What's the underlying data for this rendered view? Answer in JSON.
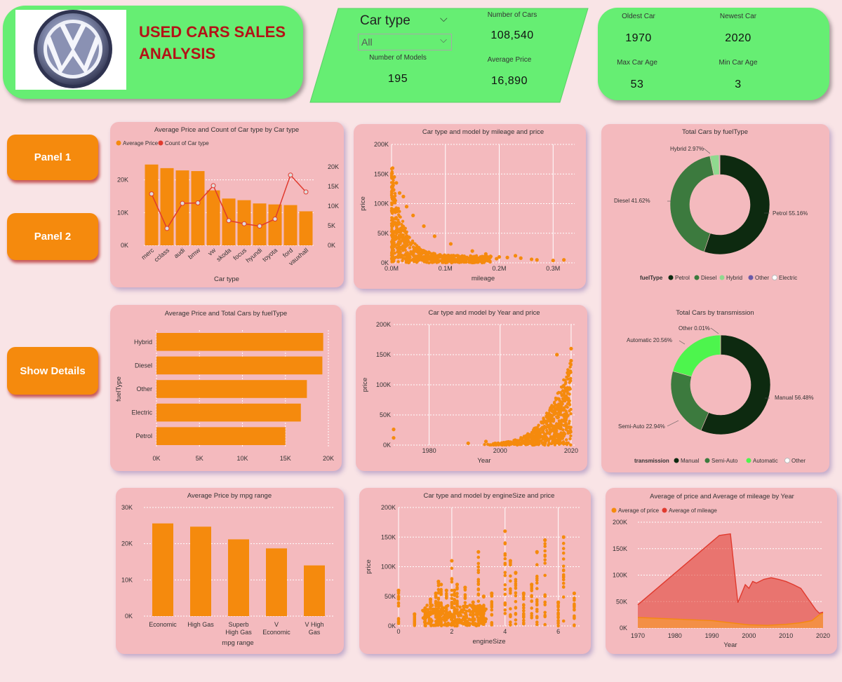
{
  "header": {
    "title_line1": "USED CARS SALES",
    "title_line2": "ANALYSIS",
    "logo_icon": "volkswagen-logo"
  },
  "filter": {
    "label": "Car type",
    "selected": "All"
  },
  "kpis": {
    "number_of_cars_label": "Number of Cars",
    "number_of_cars": "108,540",
    "number_of_models_label": "Number of Models",
    "number_of_models": "195",
    "average_price_label": "Average Price",
    "average_price": "16,890",
    "oldest_car_label": "Oldest Car",
    "oldest_car": "1970",
    "newest_car_label": "Newest Car",
    "newest_car": "2020",
    "max_car_age_label": "Max Car Age",
    "max_car_age": "53",
    "min_car_age_label": "Min Car Age",
    "min_car_age": "3"
  },
  "nav": {
    "panel1": "Panel 1",
    "panel2": "Panel 2",
    "show_details": "Show Details"
  },
  "colors": {
    "orange": "#f58a0d",
    "red": "#e03a2e",
    "green_panel": "#66ee73",
    "card": "#f4babe",
    "petrol": "#0d2a10",
    "diesel": "#3c7a3e",
    "hybrid": "#8fd98f",
    "other": "#6a5aa8",
    "electric": "#ffffff",
    "manual": "#0d2a10",
    "semi_auto": "#3c7a3e",
    "automatic": "#4df54d"
  },
  "chart_data": [
    {
      "id": "price_count_by_car_type",
      "type": "bar",
      "title": "Average Price and Count of Car type by Car type",
      "legend": [
        "Average Price",
        "Count of Car type"
      ],
      "xlabel": "Car type",
      "categories": [
        "merc",
        "cclass",
        "audi",
        "bmw",
        "vw",
        "skoda",
        "focus",
        "hyundi",
        "toyota",
        "ford",
        "vauxhall"
      ],
      "series": [
        {
          "name": "Average Price",
          "axis": "left",
          "values": [
            24700,
            23600,
            22900,
            22700,
            16800,
            14300,
            13800,
            12800,
            12500,
            12300,
            10400
          ]
        },
        {
          "name": "Count of Car type",
          "axis": "right",
          "values": [
            13100,
            4300,
            10700,
            10800,
            15200,
            6300,
            5500,
            4900,
            6700,
            17900,
            13600
          ]
        }
      ],
      "y_left_ticks": [
        "0K",
        "10K",
        "20K"
      ],
      "y_left_lim": [
        0,
        27000
      ],
      "y_right_ticks": [
        "0K",
        "5K",
        "10K",
        "15K",
        "20K"
      ],
      "y_right_lim": [
        0,
        22500
      ],
      "legend_position": "top-left"
    },
    {
      "id": "mileage_price_scatter",
      "type": "scatter",
      "title": "Car type and model by mileage and price",
      "xlabel": "mileage",
      "ylabel": "price",
      "xlim": [
        0,
        340000
      ],
      "ylim": [
        0,
        200000
      ],
      "x_ticks": [
        "0.0M",
        "0.1M",
        "0.2M",
        "0.3M"
      ],
      "y_ticks": [
        "0K",
        "50K",
        "100K",
        "150K",
        "200K"
      ],
      "outliers": [
        [
          2000,
          160000
        ],
        [
          5000,
          145000
        ],
        [
          9000,
          135000
        ],
        [
          15000,
          118000
        ],
        [
          22000,
          112000
        ],
        [
          28000,
          95000
        ],
        [
          40000,
          80000
        ],
        [
          60000,
          62000
        ],
        [
          80000,
          45000
        ],
        [
          110000,
          32000
        ],
        [
          150000,
          20000
        ],
        [
          175000,
          15000
        ],
        [
          200000,
          10000
        ],
        [
          230000,
          12000
        ],
        [
          240000,
          8000
        ],
        [
          260000,
          6000
        ],
        [
          270000,
          5000
        ],
        [
          300000,
          4000
        ],
        [
          320000,
          5000
        ],
        [
          195000,
          7000
        ],
        [
          215000,
          9000
        ]
      ]
    },
    {
      "id": "price_cars_by_fueltype",
      "type": "bar",
      "orientation": "horizontal",
      "title": "Average Price and Total Cars by fuelType",
      "ylabel": "fuelType",
      "categories": [
        "Hybrid",
        "Diesel",
        "Other",
        "Electric",
        "Petrol"
      ],
      "values": [
        19400,
        19300,
        17500,
        16800,
        15000
      ],
      "x_ticks": [
        "0K",
        "5K",
        "10K",
        "15K",
        "20K"
      ],
      "xlim": [
        0,
        20000
      ]
    },
    {
      "id": "year_price_scatter",
      "type": "scatter",
      "title": "Car type and model by Year and price",
      "xlabel": "Year",
      "ylabel": "price",
      "xlim": [
        1970,
        2021
      ],
      "ylim": [
        0,
        200000
      ],
      "x_ticks": [
        "1980",
        "2000",
        "2020"
      ],
      "y_ticks": [
        "0K",
        "50K",
        "100K",
        "150K",
        "200K"
      ],
      "outliers": [
        [
          1970,
          26000
        ],
        [
          1970,
          12000
        ],
        [
          1996,
          6000
        ],
        [
          1991,
          3000
        ],
        [
          2010,
          9000
        ],
        [
          2012,
          14000
        ],
        [
          2016,
          150000
        ],
        [
          2015,
          40000
        ],
        [
          2019,
          120000
        ],
        [
          2020,
          160000
        ],
        [
          2019,
          95000
        ],
        [
          2018,
          60000
        ],
        [
          2020,
          140000
        ]
      ]
    },
    {
      "id": "total_cars_by_fueltype",
      "type": "pie",
      "donut": true,
      "title": "Total Cars by fuelType",
      "legend_title": "fuelType",
      "categories": [
        "Petrol",
        "Diesel",
        "Hybrid",
        "Other",
        "Electric"
      ],
      "values": [
        55.16,
        41.62,
        2.97,
        0.2,
        0.05
      ],
      "labels": [
        "Petrol 55.16%",
        "Diesel 41.62%",
        "Hybrid 2.97%"
      ],
      "legend_position": "bottom"
    },
    {
      "id": "total_cars_by_transmission",
      "type": "pie",
      "donut": true,
      "title": "Total Cars by transmission",
      "legend_title": "transmission",
      "categories": [
        "Manual",
        "Semi-Auto",
        "Automatic",
        "Other"
      ],
      "values": [
        56.48,
        22.94,
        20.56,
        0.01
      ],
      "labels": [
        "Manual 56.48%",
        "Semi-Auto 22.94%",
        "Automatic 20.56%",
        "Other 0.01%"
      ],
      "legend_position": "bottom"
    },
    {
      "id": "price_by_mpg_range",
      "type": "bar",
      "title": "Average Price by mpg range",
      "xlabel": "mpg range",
      "categories": [
        "Economic",
        "High Gas",
        "Superb High Gas",
        "V Economic",
        "V High Gas"
      ],
      "category_lines": [
        [
          "Economic"
        ],
        [
          "High Gas"
        ],
        [
          "Superb",
          "High Gas"
        ],
        [
          "V",
          "Economic"
        ],
        [
          "V High",
          "Gas"
        ]
      ],
      "values": [
        25600,
        24700,
        21200,
        18700,
        14000
      ],
      "y_ticks": [
        "0K",
        "10K",
        "20K",
        "30K"
      ],
      "ylim": [
        0,
        30000
      ]
    },
    {
      "id": "enginesize_price_scatter",
      "type": "scatter",
      "title": "Car type and model by engineSize and price",
      "xlabel": "engineSize",
      "ylabel": "price",
      "xlim": [
        0,
        6.8
      ],
      "ylim": [
        0,
        200000
      ],
      "x_ticks": [
        "0",
        "2",
        "4",
        "6"
      ],
      "y_ticks": [
        "0K",
        "50K",
        "100K",
        "150K",
        "200K"
      ],
      "columns": [
        [
          0,
          60000
        ],
        [
          0.6,
          20000
        ],
        [
          1.0,
          30000
        ],
        [
          1.2,
          45000
        ],
        [
          1.4,
          55000
        ],
        [
          1.5,
          75000
        ],
        [
          1.6,
          70000
        ],
        [
          1.8,
          60000
        ],
        [
          2.0,
          110000
        ],
        [
          2.1,
          60000
        ],
        [
          2.2,
          70000
        ],
        [
          2.5,
          65000
        ],
        [
          2.8,
          40000
        ],
        [
          3.0,
          125000
        ],
        [
          3.2,
          50000
        ],
        [
          3.5,
          55000
        ],
        [
          4.0,
          160000
        ],
        [
          4.2,
          110000
        ],
        [
          4.4,
          90000
        ],
        [
          4.7,
          55000
        ],
        [
          5.0,
          70000
        ],
        [
          5.2,
          125000
        ],
        [
          5.5,
          145000
        ],
        [
          6.0,
          40000
        ],
        [
          6.2,
          150000
        ],
        [
          6.6,
          55000
        ]
      ]
    },
    {
      "id": "price_mileage_by_year",
      "type": "area",
      "title": "Average of price and Average of mileage by Year",
      "xlabel": "Year",
      "legend": [
        "Average of price",
        "Average of mileage"
      ],
      "x_ticks": [
        "1970",
        "1980",
        "1990",
        "2000",
        "2010",
        "2020"
      ],
      "y_ticks": [
        "0K",
        "50K",
        "100K",
        "150K",
        "200K"
      ],
      "xlim": [
        1970,
        2020
      ],
      "ylim": [
        0,
        200000
      ],
      "series": [
        {
          "name": "Average of mileage",
          "points": [
            [
              1970,
              44000
            ],
            [
              1992,
              175000
            ],
            [
              1995,
              178000
            ],
            [
              1997,
              48000
            ],
            [
              1999,
              82000
            ],
            [
              2000,
              75000
            ],
            [
              2001,
              88000
            ],
            [
              2002,
              85000
            ],
            [
              2004,
              92000
            ],
            [
              2006,
              95000
            ],
            [
              2008,
              92000
            ],
            [
              2010,
              88000
            ],
            [
              2012,
              82000
            ],
            [
              2014,
              75000
            ],
            [
              2016,
              55000
            ],
            [
              2018,
              35000
            ],
            [
              2019,
              28000
            ],
            [
              2020,
              30000
            ]
          ]
        },
        {
          "name": "Average of price",
          "points": [
            [
              1970,
              20000
            ],
            [
              1980,
              17000
            ],
            [
              1990,
              14000
            ],
            [
              1995,
              10000
            ],
            [
              2000,
              6000
            ],
            [
              2005,
              5000
            ],
            [
              2010,
              7000
            ],
            [
              2014,
              10000
            ],
            [
              2017,
              14000
            ],
            [
              2019,
              25000
            ],
            [
              2020,
              28000
            ]
          ]
        }
      ],
      "legend_position": "top-left"
    }
  ]
}
